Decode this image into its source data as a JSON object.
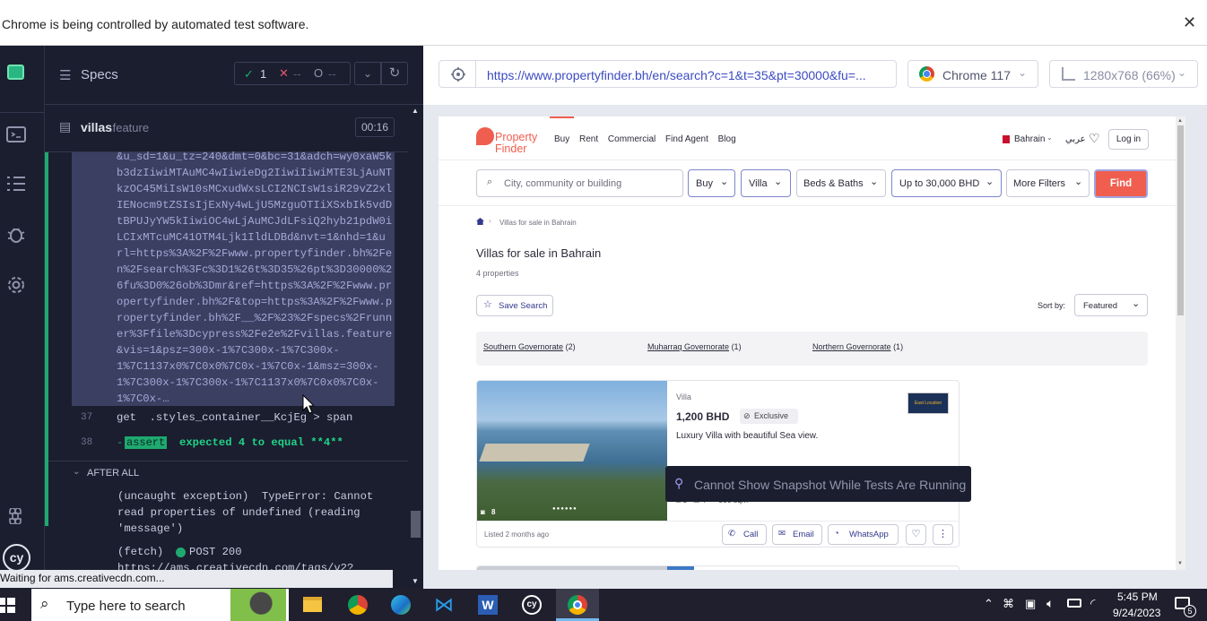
{
  "banner": {
    "text": "Chrome is being controlled by automated test software.",
    "close": "✕"
  },
  "runner": {
    "specs_label": "Specs",
    "passed": "1",
    "failed": "--",
    "pending": "--",
    "spec_file": "villas",
    "spec_ext": ".feature",
    "duration": "00:16",
    "url_log": "&u_sd=1&u_tz=240&dmt=0&bc=31&adch=wy0xaW5k\nb3dzIiwiMTAuMC4wIiwieDg2IiwiIiwiMTE3LjAuNT\nkzOC45MiIsW10sMCxudWxsLCI2NCIsW1siR29vZ2xl\nIENocm9tZSIsIjExNy4wLjU5MzguOTIiXSxbIk5vdD\ntBPUJyYW5kIiwiOC4wLjAuMCJdLFsiQ2hyb21pdW0i\nLCIxMTcuMC41OTM4Ljk1IldLDBd&nvt=1&nhd=1&u\nrl=https%3A%2F%2Fwww.propertyfinder.bh%2Fe\nn%2Fsearch%3Fc%3D1%26t%3D35%26pt%3D30000%2\n6fu%3D0%26ob%3Dmr&ref=https%3A%2F%2Fwww.pr\nopertyfinder.bh%2F&top=https%3A%2F%2Fwww.p\nropertyfinder.bh%2F__%2F%23%2Fspecs%2Frunn\ner%3Ffile%3Dcypress%2Fe2e%2Fvillas.feature\n&vis=1&psz=300x-1%7C300x-1%7C300x-\n1%7C1137x0%7C0x0%7C0x-1%7C0x-1&msz=300x-\n1%7C300x-1%7C300x-1%7C1137x0%7C0x0%7C0x-\n1%7C0x-…",
    "line37_num": "37",
    "line37": "get  .styles_container__KcjEg > span",
    "line38_num": "38",
    "line38_prefix": "-",
    "line38_badge": "assert",
    "line38_text": "expected 4 to equal **4**",
    "after_all": "AFTER ALL",
    "uncaught": "(uncaught exception)  TypeError: Cannot\nread properties of undefined (reading\n'message')",
    "fetch_prefix": "(fetch)",
    "fetch_text": "POST 200",
    "fetch_url": "https://ams.creativecdn.com/tags/v2?",
    "status_text": "Waiting for ams.creativecdn.com..."
  },
  "aut": {
    "url": "https://www.propertyfinder.bh/en/search?c=1&t=35&pt=30000&fu=...",
    "browser": "Chrome 117",
    "viewport": "1280x768 (66%)"
  },
  "site": {
    "logo_line1": "Property",
    "logo_line2": "Finder",
    "nav": [
      "Buy",
      "Rent",
      "Commercial",
      "Find Agent",
      "Blog"
    ],
    "country": "Bahrain",
    "arabic": "عربي",
    "login": "Log in",
    "search_placeholder": "City, community or building",
    "filters": [
      "Buy",
      "Villa",
      "Beds & Baths",
      "Up to 30,000 BHD",
      "More Filters"
    ],
    "find": "Find",
    "breadcrumb": "Villas for sale in Bahrain",
    "heading": "Villas for sale in Bahrain",
    "count": "4 properties",
    "save_search": "Save Search",
    "sort_label": "Sort by:",
    "sort_value": "Featured",
    "regions": [
      {
        "name": "Southern Governorate",
        "count": "(2)"
      },
      {
        "name": "Muharraq Governorate",
        "count": "(1)"
      },
      {
        "name": "Northern Governorate",
        "count": "(1)"
      }
    ],
    "listing": {
      "type": "Villa",
      "price": "1,200 BHD",
      "badge": "Exclusive",
      "title": "Luxury Villa with beautiful Sea view.",
      "photos": "8",
      "beds": "3",
      "baths": "4",
      "area": "500 sqm",
      "agency": "East Location",
      "listed": "Listed 2 months ago",
      "call": "Call",
      "email": "Email",
      "whatsapp": "WhatsApp"
    },
    "snapshot_msg": "Cannot Show Snapshot While Tests Are Running"
  },
  "taskbar": {
    "search": "Type here to search",
    "time": "5:45 PM",
    "date": "9/24/2023",
    "notif": "5"
  }
}
